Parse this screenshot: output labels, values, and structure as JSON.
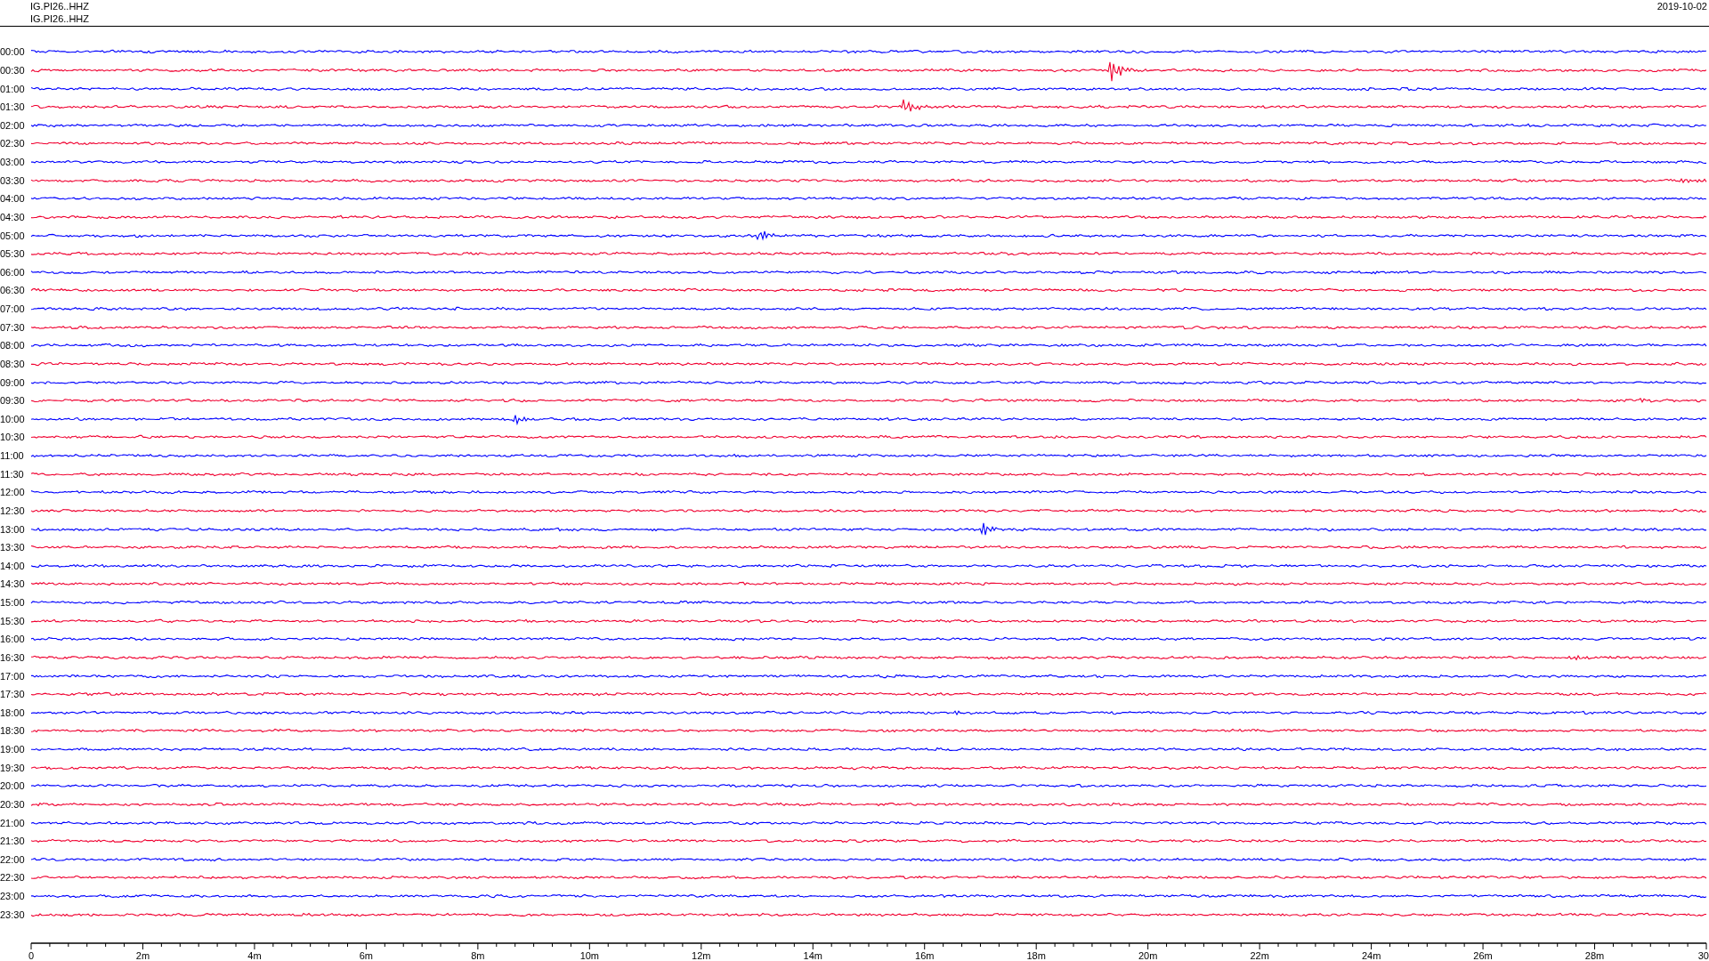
{
  "header": {
    "station_lines": [
      "IG.PI26..HHZ",
      "IG.PI26..HHZ"
    ],
    "date": "2019-10-02"
  },
  "rows": [
    {
      "time": "00:00",
      "color": "#0000ff"
    },
    {
      "time": "00:30",
      "color": "#f00030"
    },
    {
      "time": "01:00",
      "color": "#0000ff"
    },
    {
      "time": "01:30",
      "color": "#f00030"
    },
    {
      "time": "02:00",
      "color": "#0000ff"
    },
    {
      "time": "02:30",
      "color": "#f00030"
    },
    {
      "time": "03:00",
      "color": "#0000ff"
    },
    {
      "time": "03:30",
      "color": "#f00030"
    },
    {
      "time": "04:00",
      "color": "#0000ff"
    },
    {
      "time": "04:30",
      "color": "#f00030"
    },
    {
      "time": "05:00",
      "color": "#0000ff"
    },
    {
      "time": "05:30",
      "color": "#f00030"
    },
    {
      "time": "06:00",
      "color": "#0000ff"
    },
    {
      "time": "06:30",
      "color": "#f00030"
    },
    {
      "time": "07:00",
      "color": "#0000ff"
    },
    {
      "time": "07:30",
      "color": "#f00030"
    },
    {
      "time": "08:00",
      "color": "#0000ff"
    },
    {
      "time": "08:30",
      "color": "#f00030"
    },
    {
      "time": "09:00",
      "color": "#0000ff"
    },
    {
      "time": "09:30",
      "color": "#f00030"
    },
    {
      "time": "10:00",
      "color": "#0000ff"
    },
    {
      "time": "10:30",
      "color": "#f00030"
    },
    {
      "time": "11:00",
      "color": "#0000ff"
    },
    {
      "time": "11:30",
      "color": "#f00030"
    },
    {
      "time": "12:00",
      "color": "#0000ff"
    },
    {
      "time": "12:30",
      "color": "#f00030"
    },
    {
      "time": "13:00",
      "color": "#0000ff"
    },
    {
      "time": "13:30",
      "color": "#f00030"
    },
    {
      "time": "14:00",
      "color": "#0000ff"
    },
    {
      "time": "14:30",
      "color": "#f00030"
    },
    {
      "time": "15:00",
      "color": "#0000ff"
    },
    {
      "time": "15:30",
      "color": "#f00030"
    },
    {
      "time": "16:00",
      "color": "#0000ff"
    },
    {
      "time": "16:30",
      "color": "#f00030"
    },
    {
      "time": "17:00",
      "color": "#0000ff"
    },
    {
      "time": "17:30",
      "color": "#f00030"
    },
    {
      "time": "18:00",
      "color": "#0000ff"
    },
    {
      "time": "18:30",
      "color": "#f00030"
    },
    {
      "time": "19:00",
      "color": "#0000ff"
    },
    {
      "time": "19:30",
      "color": "#f00030"
    },
    {
      "time": "20:00",
      "color": "#0000ff"
    },
    {
      "time": "20:30",
      "color": "#f00030"
    },
    {
      "time": "21:00",
      "color": "#0000ff"
    },
    {
      "time": "21:30",
      "color": "#f00030"
    },
    {
      "time": "22:00",
      "color": "#0000ff"
    },
    {
      "time": "22:30",
      "color": "#f00030"
    },
    {
      "time": "23:00",
      "color": "#0000ff"
    },
    {
      "time": "23:30",
      "color": "#f00030"
    }
  ],
  "axis": {
    "labels": [
      "0",
      "2m",
      "4m",
      "6m",
      "8m",
      "10m",
      "12m",
      "14m",
      "16m",
      "18m",
      "20m",
      "22m",
      "24m",
      "26m",
      "28m",
      "30"
    ]
  }
}
